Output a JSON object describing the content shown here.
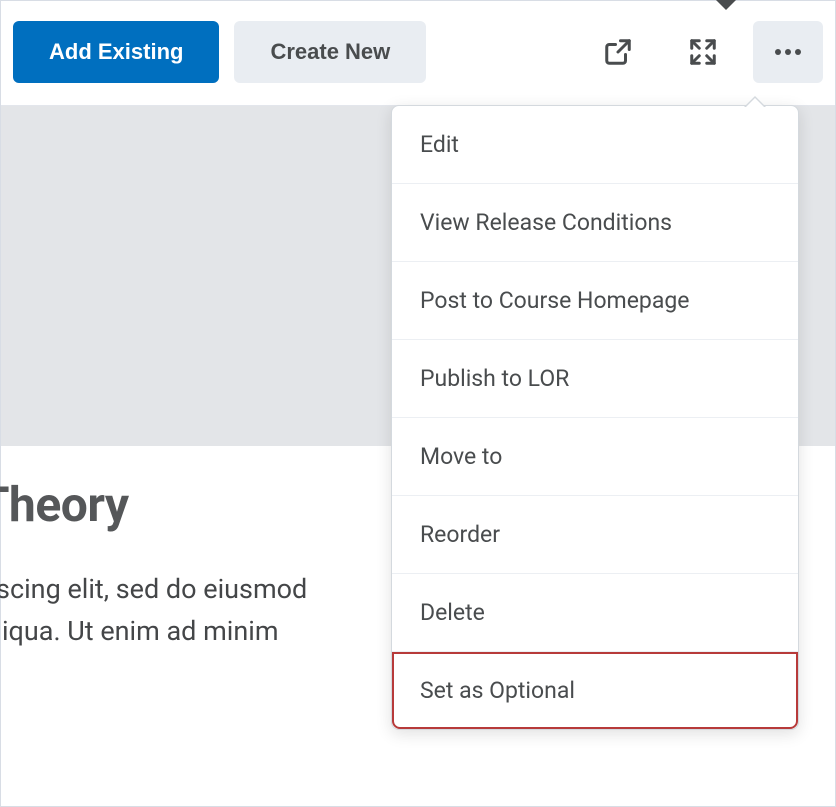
{
  "toolbar": {
    "add_existing_label": "Add Existing",
    "create_new_label": "Create New"
  },
  "content": {
    "title_fragment": "ang Theory",
    "body_line1": "ctetur adipiscing elit, sed do eiusmod",
    "body_line2": "re magna aliqua. Ut enim ad minim"
  },
  "menu": {
    "items": [
      {
        "label": "Edit"
      },
      {
        "label": "View Release Conditions"
      },
      {
        "label": "Post to Course Homepage"
      },
      {
        "label": "Publish to LOR"
      },
      {
        "label": "Move to"
      },
      {
        "label": "Reorder"
      },
      {
        "label": "Delete"
      },
      {
        "label": "Set as Optional"
      }
    ]
  }
}
